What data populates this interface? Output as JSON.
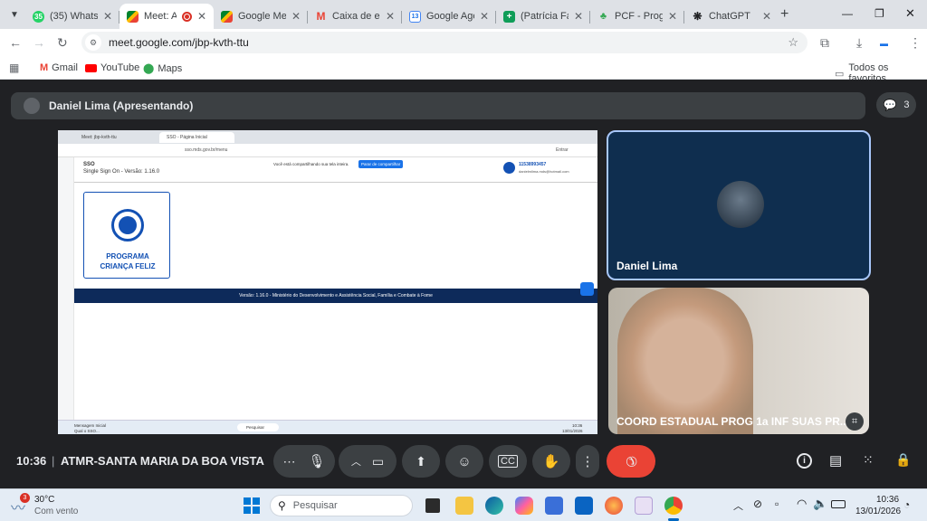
{
  "browser": {
    "tabs": [
      {
        "label": "(35) WhatsA",
        "icon": "whatsapp-icon",
        "badge": "35",
        "color": "#25d366"
      },
      {
        "label": "Meet: AT",
        "icon": "meet-icon",
        "active": true,
        "recording": true
      },
      {
        "label": "Google Mee",
        "icon": "meet-icon"
      },
      {
        "label": "Caixa de ent",
        "icon": "gmail-icon"
      },
      {
        "label": "Google Age",
        "icon": "calendar-icon",
        "badge": "13"
      },
      {
        "label": "(Patrícia Falc",
        "icon": "sheets-icon"
      },
      {
        "label": "PCF - Progra",
        "icon": "pcf-icon"
      },
      {
        "label": "ChatGPT",
        "icon": "chatgpt-icon"
      }
    ],
    "url": "meet.google.com/jbp-kvth-ttu",
    "bookmarks": [
      {
        "label": "Gmail",
        "icon": "gmail-icon"
      },
      {
        "label": "YouTube",
        "icon": "youtube-icon"
      },
      {
        "label": "Maps",
        "icon": "maps-icon"
      }
    ],
    "all_bookmarks": "Todos os favoritos"
  },
  "meet": {
    "presenter_label": "Daniel Lima (Apresentando)",
    "people_count": "3",
    "participants": [
      {
        "name": "Daniel Lima"
      },
      {
        "name": "COORD ESTADUAL PROG 1a INF SUAS PR..."
      }
    ],
    "time": "10:36",
    "meeting_name": "ATMR-SANTA MARIA DA BOA VISTA"
  },
  "shared_screen": {
    "tabs": [
      "Meet: jbp-kvth-ttu",
      "SSO - Página Inicial"
    ],
    "url": "sso.mds.gov.br/menu",
    "share_notice": "Você está compartilhando sua tela inteira.",
    "stop_share": "Parar de compartilhar",
    "user_profile": "Entrar",
    "sso_title": "SSO",
    "sso_subtitle": "Single Sign On -  Versão: 1.16.0",
    "user_id": "11538993457",
    "user_email": "danielmlima.mds@hotmail.com",
    "card_title_1": "PROGRAMA",
    "card_title_2": "CRIANÇA FELIZ",
    "footer": "Versão: 1.16.0 - Ministério do Desenvolvimento e Assistência Social, Família e Combate à Fome",
    "weather_line1": "Mensagem Inicial",
    "weather_line2": "Qual o SSO...",
    "search": "Pesquisar",
    "clock_time": "10:36",
    "clock_date": "13/01/2026"
  },
  "taskbar": {
    "weather_temp": "30°C",
    "weather_desc": "Com vento",
    "weather_badge": "3",
    "search_placeholder": "Pesquisar",
    "time": "10:36",
    "date": "13/01/2026"
  },
  "colors": {
    "meet_bg": "#202124",
    "end_call": "#ea4335",
    "active_tile_border": "#a8c7fa",
    "sso_navy": "#0d2a5a",
    "sso_blue": "#1351b4"
  }
}
